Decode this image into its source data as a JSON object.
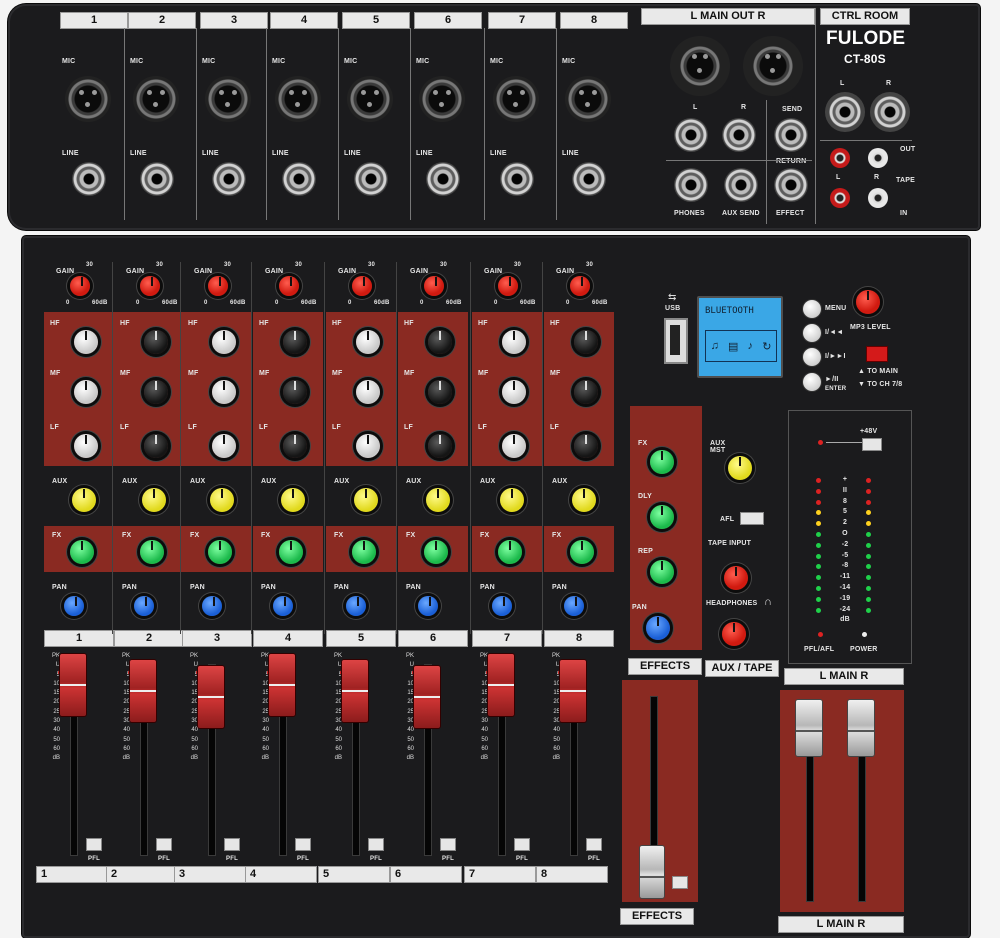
{
  "brand": {
    "name": "FULODE",
    "model": "CT-80S"
  },
  "channels": [
    {
      "num": "1"
    },
    {
      "num": "2"
    },
    {
      "num": "3"
    },
    {
      "num": "4"
    },
    {
      "num": "5"
    },
    {
      "num": "6"
    },
    {
      "num": "7"
    },
    {
      "num": "8"
    }
  ],
  "top_labels": {
    "main_out": "L   MAIN OUT   R",
    "ctrl_room": "CTRL ROOM",
    "mic": "MIC",
    "line": "LINE",
    "l": "L",
    "r": "R",
    "phones": "PHONES",
    "aux_send": "AUX SEND",
    "send": "SEND",
    "return": "RETURN",
    "effect": "EFFECT",
    "out": "OUT",
    "tape": "TAPE",
    "in": "IN"
  },
  "strip_labels": {
    "gain": "GAIN",
    "hf": "HF",
    "mf": "MF",
    "lf": "LF",
    "aux": "AUX",
    "fx": "FX",
    "pan": "PAN",
    "pfl": "PFL",
    "gain_max": "60dB",
    "gain_mid": "30",
    "gain_min": "0"
  },
  "mp3": {
    "display": "BLUETOOTH",
    "usb": "USB",
    "menu": "MENU",
    "prev": "I/◄◄",
    "next": "I/►►I",
    "play": "►/II",
    "enter": "ENTER",
    "mp3_level": "MP3 LEVEL",
    "to_main": "▲ TO MAIN",
    "to_ch": "▼ TO CH 7/8"
  },
  "effects_col": {
    "fx": "FX",
    "dly": "DLY",
    "rep": "REP",
    "pan": "PAN",
    "label": "EFFECTS"
  },
  "aux_tape": {
    "aux_mst": "AUX MST",
    "afl": "AFL",
    "tape_input": "TAPE INPUT",
    "headphones": "HEADPHONES",
    "label": "AUX / TAPE"
  },
  "meter": {
    "phantom": "+48V",
    "marks": [
      "+",
      "II",
      "8",
      "5",
      "2",
      "O",
      "-2",
      "-5",
      "-8",
      "-11",
      "-14",
      "-19",
      "-24",
      "dB"
    ],
    "pfl_afl": "PFL/AFL",
    "power": "POWER",
    "main_label": "L    MAIN    R"
  },
  "fader_scale": [
    "PK",
    "",
    "U",
    "",
    "5",
    "10",
    "15",
    "20",
    "25",
    "30",
    "40",
    "50",
    "60",
    "dB"
  ],
  "colors": {
    "panel": "#1b1b1d",
    "accent_red": "#8a2a22"
  }
}
